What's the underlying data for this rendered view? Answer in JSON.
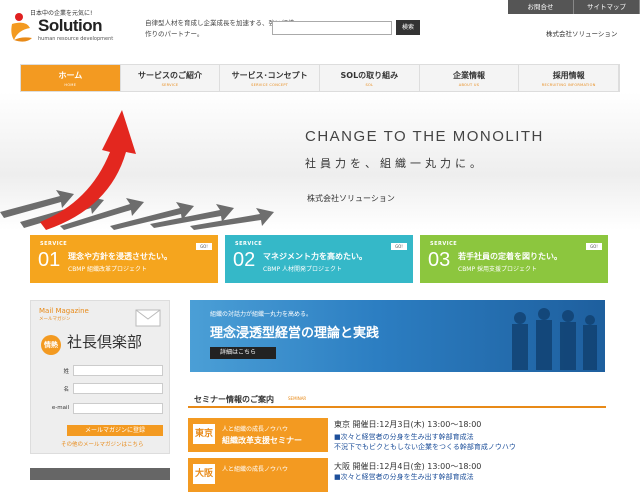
{
  "header": {
    "logo_top": "日本中の企業を元気に!",
    "logo_name": "Solution",
    "logo_sub": "human resource development",
    "tagline": "自律型人材を育成し企業成長を加速する、強い組織作りのパートナー。",
    "search_button": "検索",
    "util_links": [
      "お問合せ",
      "サイトマップ"
    ],
    "company": "株式会社ソリューション"
  },
  "nav": [
    {
      "label": "ホーム",
      "sub": "HOME"
    },
    {
      "label": "サービスのご紹介",
      "sub": "SERVICE"
    },
    {
      "label": "サービス･コンセプト",
      "sub": "SERVICE CONCEPT"
    },
    {
      "label": "SOLの取り組み",
      "sub": "SOL"
    },
    {
      "label": "企業情報",
      "sub": "ABOUT US"
    },
    {
      "label": "採用情報",
      "sub": "RECRUITING INFORMATION"
    }
  ],
  "hero": {
    "headline": "CHANGE TO THE MONOLITH",
    "sub": "社員力を、組織一丸力に。",
    "company": "株式会社ソリューション"
  },
  "services": [
    {
      "tag": "SERVICE",
      "num": "01",
      "title": "理念や方針を浸透させたい。",
      "desc": "CBMP 組織改革プロジェクト",
      "go": "GO!",
      "color": "#f5a51e"
    },
    {
      "tag": "SERVICE",
      "num": "02",
      "title": "マネジメント力を高めたい。",
      "desc": "CBMP 人材開発プロジェクト",
      "go": "GO!",
      "color": "#35b8c8"
    },
    {
      "tag": "SERVICE",
      "num": "03",
      "title": "若手社員の定着を図りたい。",
      "desc": "CBMP 採用支援プロジェクト",
      "go": "GO!",
      "color": "#8cc63e"
    }
  ],
  "mail": {
    "title": "Mail Magazine",
    "sub": "メールマガジン",
    "badge": "情熱",
    "club": "社長倶楽部",
    "fields": [
      "姓",
      "名",
      "e-mail"
    ],
    "submit": "メールマガジンに登録",
    "other": "その他のメールマガジンはこちら"
  },
  "banner": {
    "small": "組織の対話力が組織一丸力を高める。",
    "title": "理念浸透型経営の理論と実践",
    "button": "詳細はこちら"
  },
  "seminar": {
    "title": "セミナー情報のご案内",
    "sub": "SEMINAR",
    "items": [
      {
        "city": "東京",
        "l1": "人と組織の成長ノウハウ",
        "l2": "組織改革支援セミナー",
        "info": "東京 開催日:12月3日(木) 13:00～18:00",
        "link1": "■次々と経営者の分身を生み出す幹部育成法",
        "link2": "不況下でもビクともしない企業をつくる幹部育成ノウハウ"
      },
      {
        "city": "大阪",
        "l1": "人と組織の成長ノウハウ",
        "l2": "",
        "info": "大阪 開催日:12月4日(金) 13:00～18:00",
        "link1": "■次々と経営者の分身を生み出す幹部育成法",
        "link2": ""
      }
    ]
  }
}
